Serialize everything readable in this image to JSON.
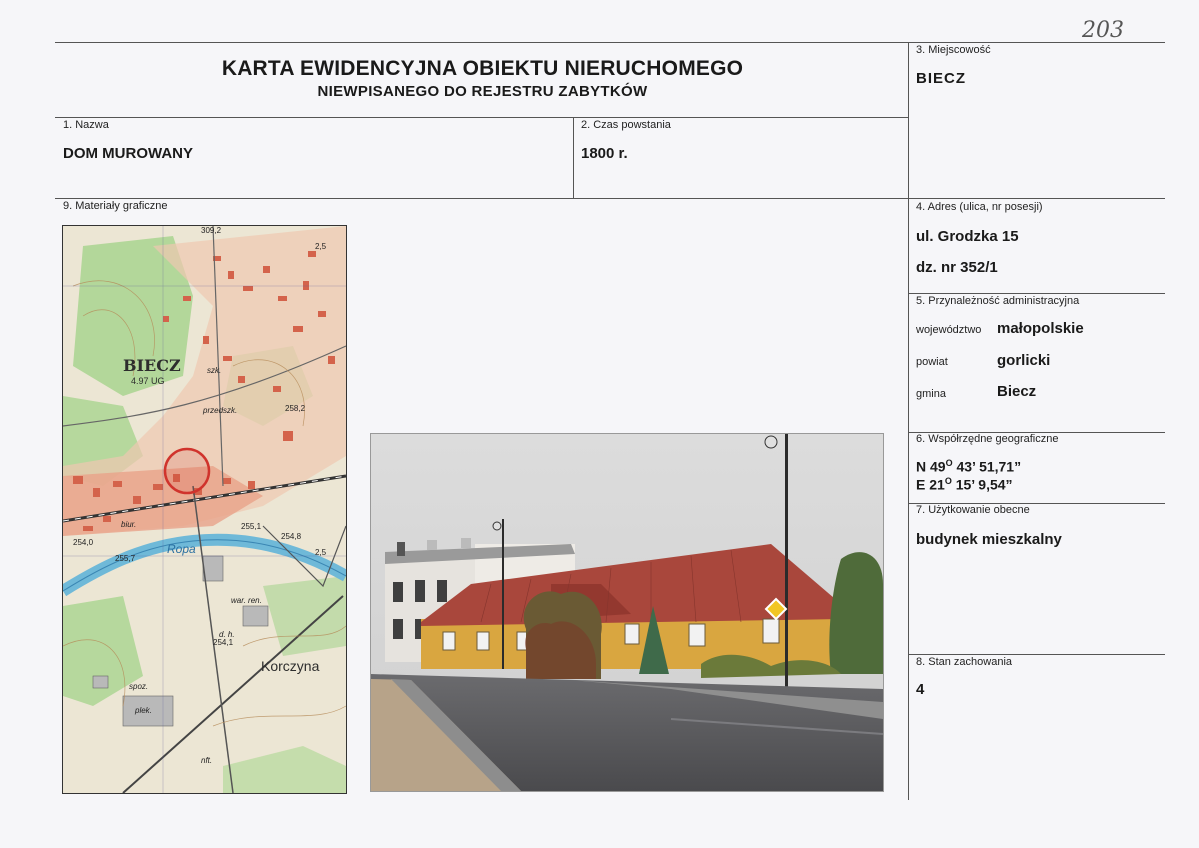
{
  "page_number": "203",
  "title": {
    "line1": "KARTA EWIDENCYJNA OBIEKTU NIERUCHOMEGO",
    "line2": "NIEWPISANEGO DO REJESTRU ZABYTKÓW"
  },
  "fields": {
    "miejscowosc": {
      "label": "3. Miejscowość",
      "value": "BIECZ"
    },
    "nazwa": {
      "label": "1. Nazwa",
      "value": "DOM MUROWANY"
    },
    "czas": {
      "label": "2. Czas powstania",
      "value": "1800 r."
    },
    "materialy": {
      "label": "9. Materiały graficzne"
    },
    "adres": {
      "label": "4. Adres (ulica, nr posesji)",
      "line1": "ul. Grodzka 15",
      "line2": "dz. nr 352/1"
    },
    "admin": {
      "label": "5. Przynależność administracyjna",
      "rows": [
        {
          "key": "województwo",
          "value": "małopolskie"
        },
        {
          "key": "powiat",
          "value": "gorlicki"
        },
        {
          "key": "gmina",
          "value": "Biecz"
        }
      ]
    },
    "wspolrzedne": {
      "label": "6. Współrzędne geograficzne",
      "n_prefix": "N 49",
      "n_rest": " 43’ 51,71”",
      "e_prefix": "E 21",
      "e_rest": " 15’ 9,54”",
      "degree": "O"
    },
    "uzytkowanie": {
      "label": "7. Użytkowanie obecne",
      "value": "budynek mieszkalny"
    },
    "stan": {
      "label": "8. Stan zachowania",
      "value": "4"
    }
  },
  "map_labels": {
    "town": "BIECZ",
    "town_sub": "4.97 UG",
    "village": "Korczyna",
    "river": "Ropa",
    "elev1": "309,2",
    "elev2": "255,7",
    "elev3": "254,0",
    "elev4": "254,1",
    "elev5": "255,1",
    "elev6": "254,8",
    "elev7": "2,5",
    "elev8": "258,2",
    "elev9": "2,5",
    "przedszk": "przedszk.",
    "szk": "szk.",
    "biur": "biur.",
    "nft": "nft.",
    "plek": "plek.",
    "spoz": "spoz.",
    "war_ren": "war. ren.",
    "dh": "d. h."
  },
  "colors": {
    "map_green": "#9fd08a",
    "map_urban": "#e2866e",
    "map_water": "#7fc4df",
    "wall_yellow": "#d9a640",
    "roof": "#a9473c",
    "circle": "#d0332c"
  }
}
